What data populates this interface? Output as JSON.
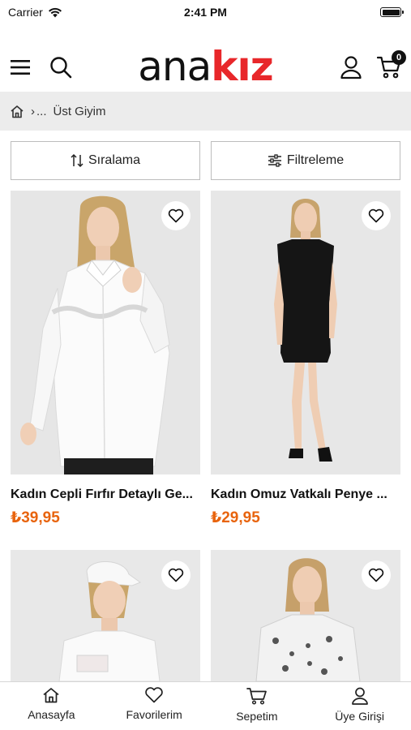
{
  "status": {
    "carrier": "Carrier",
    "time": "2:41 PM"
  },
  "header": {
    "logo_part1": "ana",
    "logo_part2": "kız",
    "cart_count": "0"
  },
  "breadcrumb": {
    "ellipsis": "...",
    "current": "Üst Giyim"
  },
  "controls": {
    "sort_label": "Sıralama",
    "filter_label": "Filtreleme"
  },
  "products": [
    {
      "title": "Kadın Cepli Fırfır Detaylı Ge...",
      "price": "₺39,95"
    },
    {
      "title": "Kadın Omuz Vatkalı Penye ...",
      "price": "₺29,95"
    },
    {
      "title": "",
      "price": ""
    },
    {
      "title": "",
      "price": ""
    }
  ],
  "tabbar": [
    {
      "label": "Anasayfa",
      "icon": "home-icon"
    },
    {
      "label": "Favorilerim",
      "icon": "heart-icon"
    },
    {
      "label": "Sepetim",
      "icon": "cart-icon"
    },
    {
      "label": "Üye Girişi",
      "icon": "user-icon"
    }
  ],
  "colors": {
    "brand_red": "#e8272a",
    "price_orange": "#e8640e",
    "breadcrumb_bg": "#ececec"
  }
}
